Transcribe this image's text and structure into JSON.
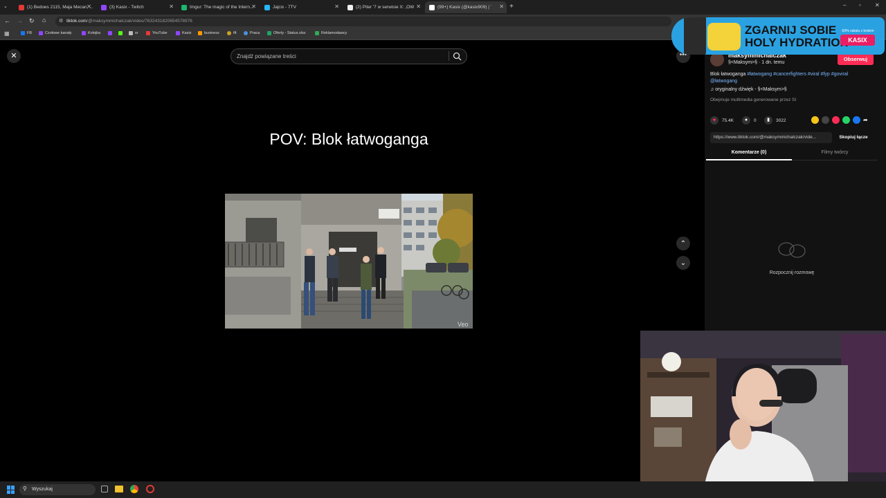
{
  "browser": {
    "tabs": [
      {
        "title": "(1) Bedoes 2115, Maja Mecan, ...",
        "color": "#e53935"
      },
      {
        "title": "(3) Kasix - Twitch",
        "color": "#9146ff"
      },
      {
        "title": "Imgur: The magic of the Intern...",
        "color": "#1bb76e"
      },
      {
        "title": "Jajcix - 7TV",
        "color": "#29b6f6"
      },
      {
        "title": "(2) Piter '7 w serwisie X: ,OWN...",
        "color": "#eeeeee"
      },
      {
        "title": "(99+) Kasix (@kasix909) | Ti...",
        "color": "#ffffff"
      }
    ],
    "url_host": "tiktok.com",
    "url_path": "/@maksymmichalczak/video/7632431820654578976",
    "bookmarks": [
      "FB",
      "Czołowe kanały",
      "Kolejka",
      "",
      "",
      "sr",
      "YouTube",
      "Kasix",
      "business",
      "tft",
      "Praca",
      "Oferty - Status.xlsx",
      "Reklamodawcy"
    ]
  },
  "player": {
    "search_placeholder": "Znajdź powiązane treści",
    "title": "POV: Blok łatwoganga",
    "watermark": "Veo"
  },
  "panel": {
    "username": "maksymmichalczak",
    "meta": "§<Maksym>§ · 1 dn. temu",
    "follow_label": "Obserwuj",
    "desc_plain": "Blok łatwoganga ",
    "desc_tags": "#łatwogang #cancerfighters #viral #fyp #goviral @łatwogang",
    "sound": "oryginalny dźwięk - §<Maksym>§",
    "ai_note": "Obejmuje multimedia generowane przez SI",
    "likes": "75.4K",
    "comments": "0",
    "saves": "3022",
    "link": "https://www.tiktok.com/@maksymmichalczak/vide...",
    "copy_label": "Skopiuj łącze",
    "tab_comments": "Komentarze (0)",
    "tab_creator": "Filmy twórcy",
    "empty_label": "Rozpocznij rozmowę"
  },
  "ad": {
    "line1": "ZGARNIJ SOBIE",
    "line2": "HOLY HYDRATION",
    "brand": "KASIX",
    "small": "-50% rabatu z kodem"
  },
  "taskbar": {
    "search_label": "Wyszukaj"
  },
  "colors": {
    "accent": "#fe2c55",
    "tag": "#7ab8ff"
  }
}
